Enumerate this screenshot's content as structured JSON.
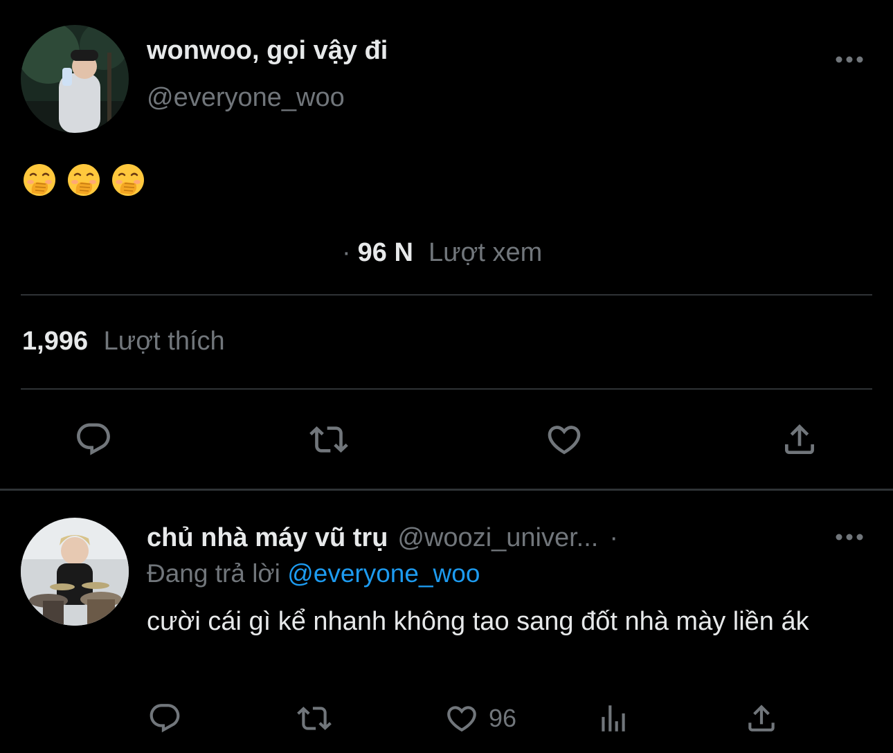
{
  "tweet": {
    "display_name": "wonwoo, gọi vậy đi",
    "handle": "@everyone_woo",
    "emojis": [
      "face-with-hand-over-mouth",
      "face-with-hand-over-mouth",
      "face-with-hand-over-mouth"
    ],
    "views_separator": "·",
    "views_value": "96 N",
    "views_label": "Lượt xem",
    "likes_value": "1,996",
    "likes_label": "Lượt thích",
    "actions": [
      "reply-icon",
      "retweet-icon",
      "heart-icon",
      "share-icon"
    ]
  },
  "reply": {
    "display_name": "chủ nhà máy vũ trụ",
    "handle": "@woozi_univer...",
    "separator": "·",
    "replying_to_label": "Đang trả lời",
    "replying_to_handle": "@everyone_woo",
    "text": "cười cái gì kể nhanh không tao sang đốt nhà mày liền ák",
    "like_count": "96",
    "actions": [
      "reply-icon",
      "retweet-icon",
      "heart-icon",
      "analytics-icon",
      "share-icon"
    ]
  },
  "colors": {
    "background": "#000000",
    "text_primary": "#e7e9ea",
    "text_secondary": "#71767b",
    "link": "#1d9bf0",
    "divider": "#2f3336"
  }
}
